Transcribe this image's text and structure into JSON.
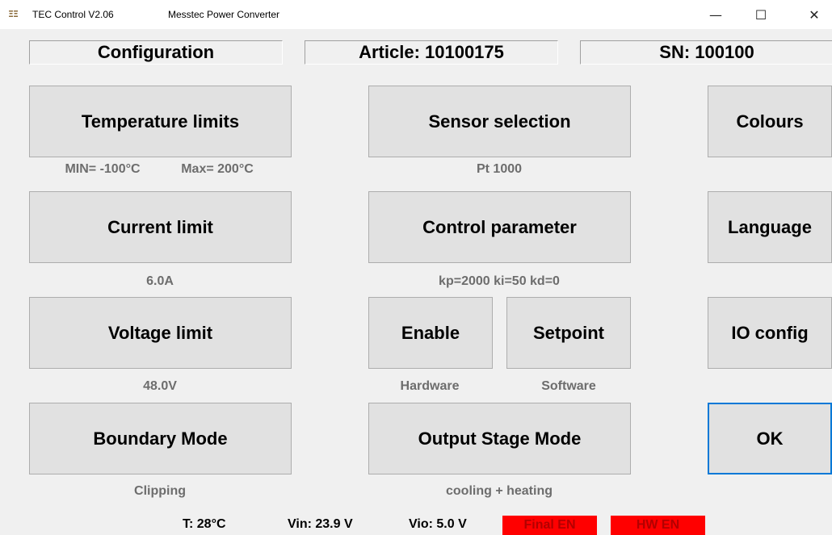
{
  "window": {
    "app_title": "TEC Control V2.06",
    "subtitle": "Messtec Power Converter",
    "icon_glyph": "ΞΞ",
    "minimize_glyph": "—",
    "maximize_glyph": "☐",
    "close_glyph": "✕"
  },
  "header": {
    "configuration": "Configuration",
    "article": "Article: 10100175",
    "sn": "SN: 100100"
  },
  "buttons": {
    "temperature_limits": "Temperature limits",
    "sensor_selection": "Sensor selection",
    "colours": "Colours",
    "current_limit": "Current limit",
    "control_parameter": "Control parameter",
    "language": "Language",
    "voltage_limit": "Voltage limit",
    "enable": "Enable",
    "setpoint": "Setpoint",
    "io_config": "IO config",
    "boundary_mode": "Boundary Mode",
    "output_stage_mode": "Output Stage Mode",
    "ok": "OK"
  },
  "values": {
    "temperature_min": "MIN= -100°C",
    "temperature_max": "Max= 200°C",
    "sensor": "Pt 1000",
    "current": "6.0A",
    "control": "kp=2000 ki=50 kd=0",
    "voltage": "48.0V",
    "enable_source": "Hardware",
    "setpoint_source": "Software",
    "boundary": "Clipping",
    "output_stage": "cooling + heating"
  },
  "status": {
    "temperature": "T:  28°C",
    "vin": "Vin:  23.9 V",
    "vio": "Vio: 5.0 V",
    "final_en": "Final EN",
    "hw_en": "HW EN"
  },
  "colors": {
    "button_face": "#e1e1e1",
    "default_border": "#0078d7",
    "badge_red": "#ff0000",
    "sub_text": "#6d6d6d"
  }
}
